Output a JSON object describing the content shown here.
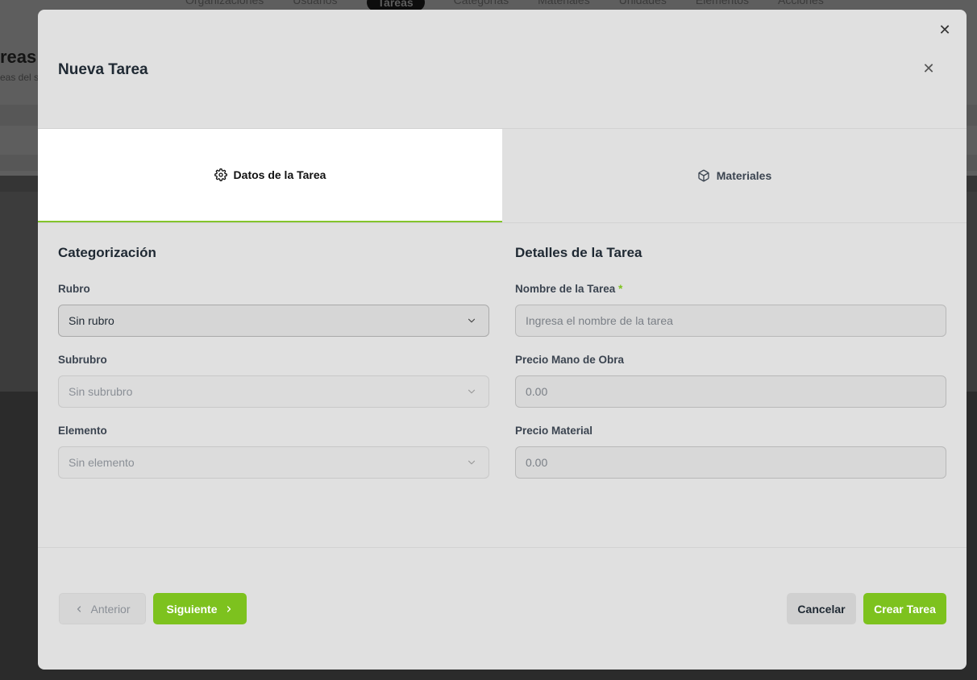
{
  "background": {
    "nav_items": [
      "Organizaciones",
      "Usuarios",
      "Tareas",
      "Categorías",
      "Materiales",
      "Unidades",
      "Elementos",
      "Acciones"
    ],
    "page_title": "reas",
    "page_subtitle": "eas del s"
  },
  "modal": {
    "title": "Nueva Tarea",
    "tabs": [
      {
        "label": "Datos de la Tarea",
        "icon": "gear-icon"
      },
      {
        "label": "Materiales",
        "icon": "cube-icon"
      }
    ],
    "categorization": {
      "title": "Categorización",
      "rubro_label": "Rubro",
      "rubro_value": "Sin rubro",
      "subrubro_label": "Subrubro",
      "subrubro_value": "Sin subrubro",
      "elemento_label": "Elemento",
      "elemento_value": "Sin elemento"
    },
    "details": {
      "title": "Detalles de la Tarea",
      "name_label": "Nombre de la Tarea",
      "required_mark": "*",
      "name_placeholder": "Ingresa el nombre de la tarea",
      "labor_label": "Precio Mano de Obra",
      "labor_placeholder": "0.00",
      "material_label": "Precio Material",
      "material_placeholder": "0.00"
    },
    "footer": {
      "prev_label": "Anterior",
      "next_label": "Siguiente",
      "cancel_label": "Cancelar",
      "create_label": "Crear Tarea"
    }
  },
  "colors": {
    "accent": "#7dc21e",
    "modal_bg": "#e0e0e0",
    "overlay": "#2b2b2b"
  }
}
